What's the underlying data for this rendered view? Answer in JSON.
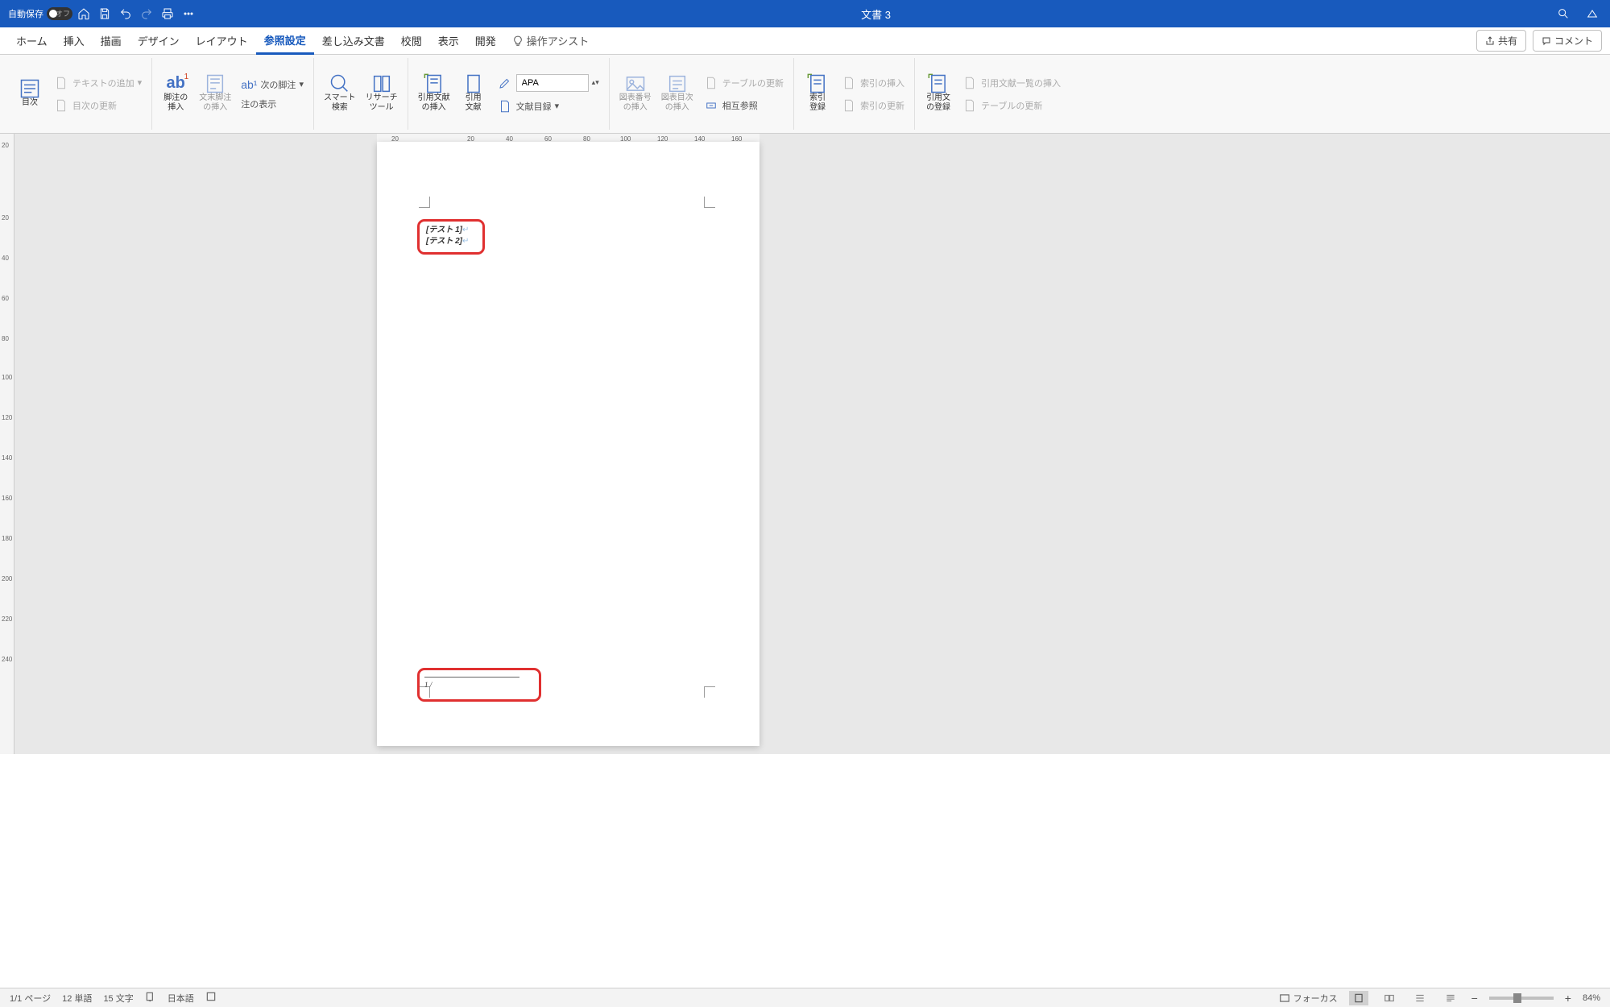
{
  "title_bar": {
    "autosave_label": "自動保存",
    "autosave_toggle": "オフ",
    "document_title": "文書 3"
  },
  "tabs": {
    "items": [
      "ホーム",
      "挿入",
      "描画",
      "デザイン",
      "レイアウト",
      "参照設定",
      "差し込み文書",
      "校閲",
      "表示",
      "開発"
    ],
    "active_index": 5,
    "tell_me": "操作アシスト",
    "share": "共有",
    "comment": "コメント"
  },
  "ribbon": {
    "toc": {
      "label": "目次",
      "add_text": "テキストの追加",
      "update": "目次の更新"
    },
    "footnote": {
      "insert": "脚注の\n挿入",
      "endnote": "文末脚注\nの挿入",
      "next": "次の脚注",
      "show": "注の表示",
      "ab": "ab"
    },
    "research": {
      "smart": "スマート\n検索",
      "tool": "リサーチ\nツール"
    },
    "citation": {
      "insert": "引用文献\nの挿入",
      "manage": "引用\n文献",
      "style_label": "APA",
      "biblio": "文献目録"
    },
    "caption": {
      "fig": "図表番号\nの挿入",
      "tof": "図表目次\nの挿入",
      "update_tof": "テーブルの更新",
      "xref": "相互参照"
    },
    "index": {
      "mark": "索引\n登録",
      "insert": "索引の挿入",
      "update": "索引の更新"
    },
    "authorities": {
      "mark": "引用文\nの登録",
      "insert": "引用文献一覧の挿入",
      "update": "テーブルの更新"
    }
  },
  "document": {
    "body_lines": [
      "[テスト 1]",
      "[テスト 2]"
    ],
    "footnote_text": "1 /"
  },
  "ruler_h": [
    "20",
    "20",
    "40",
    "60",
    "80",
    "100",
    "120",
    "140",
    "160"
  ],
  "ruler_v": [
    "20",
    "20",
    "40",
    "60",
    "80",
    "100",
    "120",
    "140",
    "160",
    "180",
    "200",
    "220",
    "240"
  ],
  "status": {
    "page": "1/1 ページ",
    "words": "12 単語",
    "chars": "15 文字",
    "lang": "日本語",
    "focus": "フォーカス",
    "zoom": "84%"
  }
}
